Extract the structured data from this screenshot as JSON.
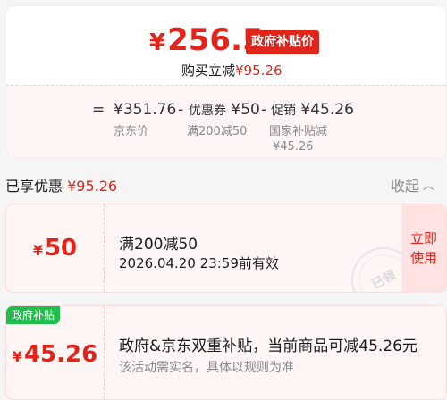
{
  "price_card": {
    "currency": "¥",
    "final_price": "256.5",
    "gov_badge": "政府补贴价",
    "buy_reduce_label": "购买立减",
    "buy_reduce_amount": "¥95.26",
    "formula": {
      "equals": "=",
      "jd_price": "¥351.76",
      "minus1": "-",
      "coupon_label": "优惠券",
      "coupon_amount": "¥50",
      "minus2": "-",
      "promo_label": "促销",
      "promo_amount": "¥45.26"
    },
    "sub_labels": {
      "jd_price": "京东价",
      "coupon": "满200减50",
      "promo_line1": "国家补贴减",
      "promo_line2": "¥45.26"
    }
  },
  "summary": {
    "label": "已享优惠",
    "amount": "¥95.26",
    "collapse_label": "收起",
    "collapse_icon": "chevron-up-icon"
  },
  "coupon": {
    "currency": "¥",
    "value": "50",
    "title": "满200减50",
    "expiry": "2026.04.20 23:59前有效",
    "stamp_text": "已领",
    "claim_line1": "立即",
    "claim_line2": "使用"
  },
  "subsidy": {
    "tag": "政府补贴",
    "currency": "¥",
    "value": "45.26",
    "description": "政府&京东双重补贴，当前商品可减45.26元",
    "note": "该活动需实名，具体以规则为准"
  },
  "colors": {
    "accent_red": "#e1251b",
    "tag_green": "#1dbf4a",
    "card_tint": "#fff5f5"
  }
}
